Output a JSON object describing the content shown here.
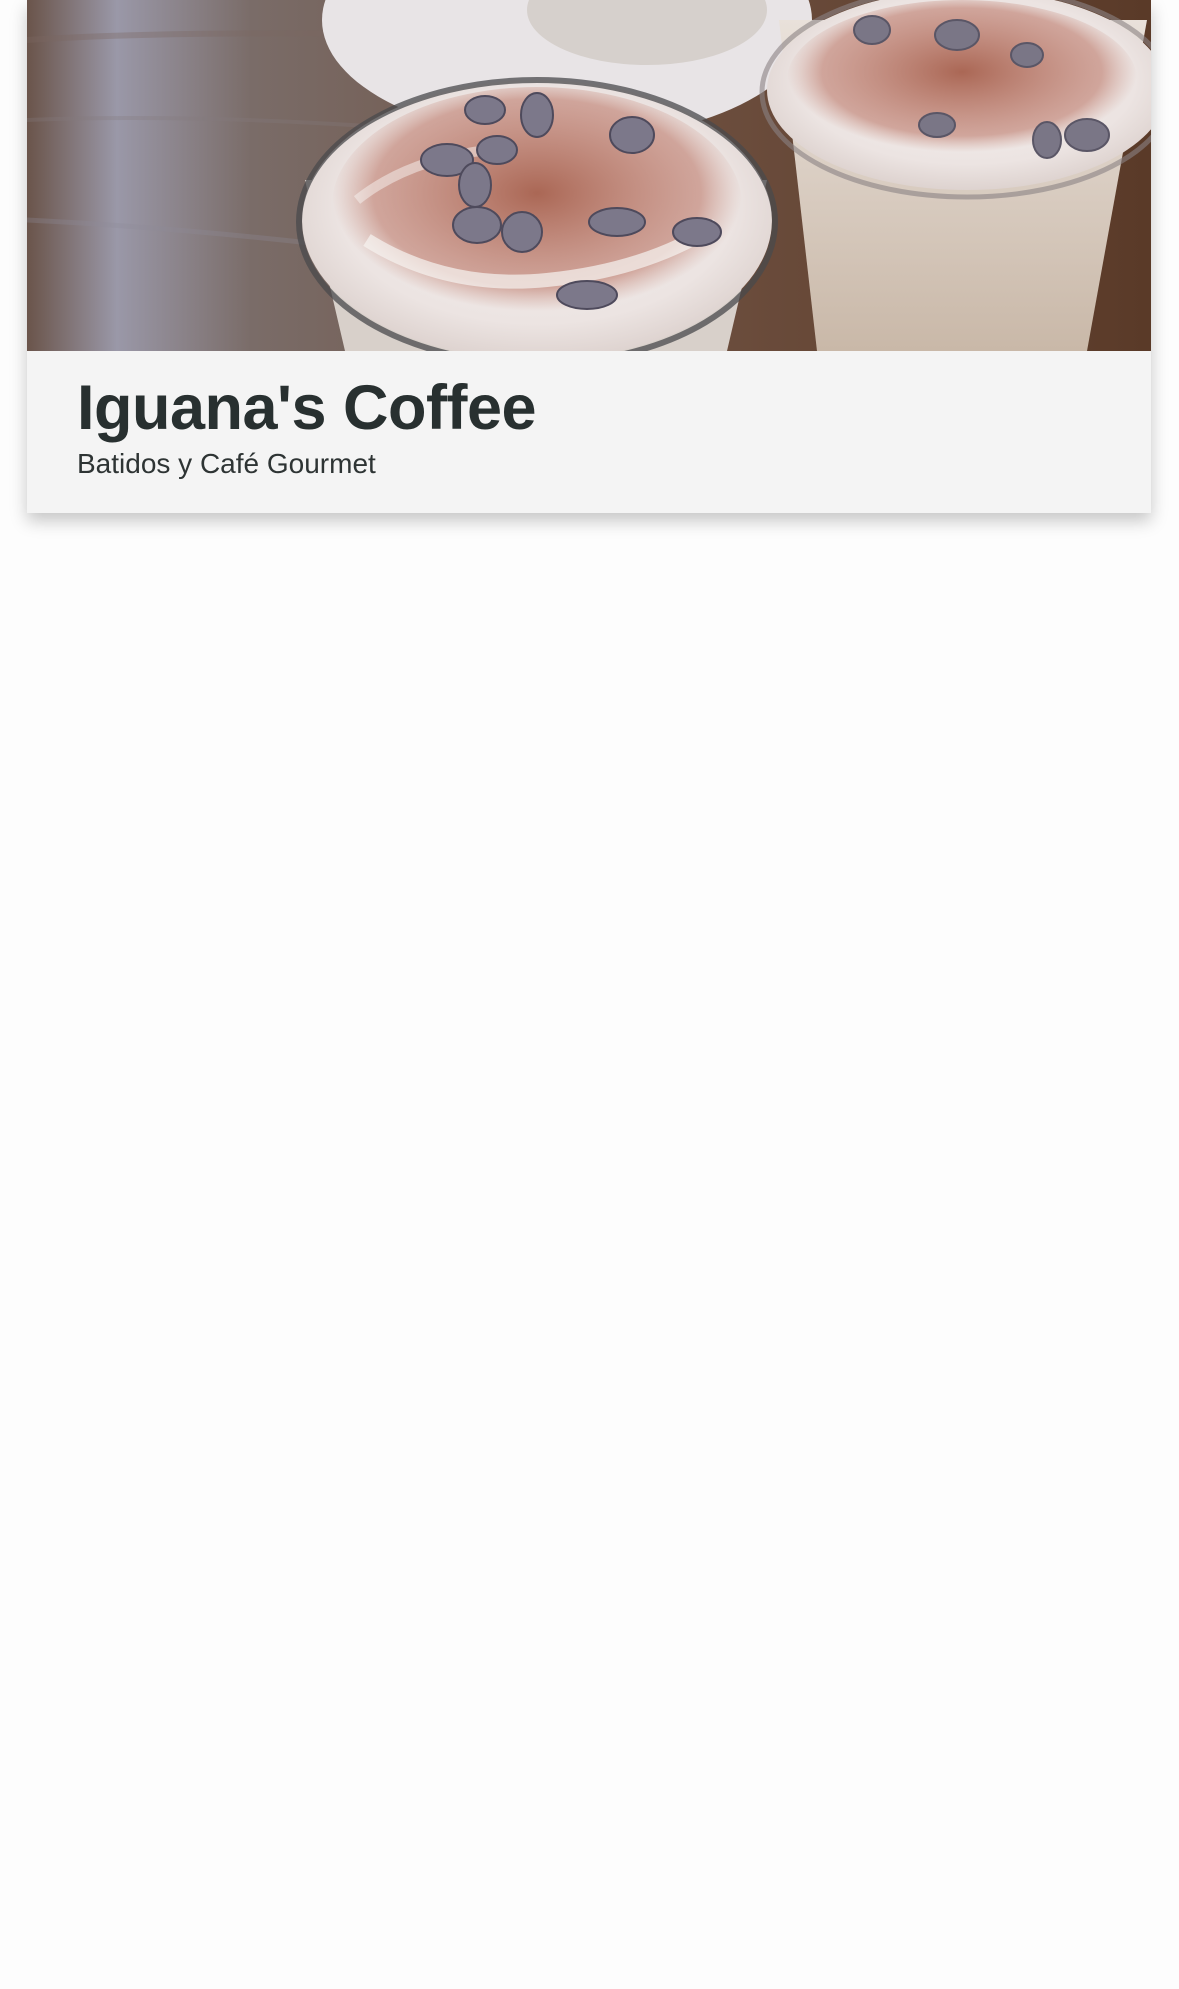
{
  "header": {
    "title": "Iguana's Coffee",
    "subtitle": "Batidos y Café Gourmet"
  },
  "hero_image": {
    "icon": "milkshake-photo",
    "description_alt": "Iguana's Coffee"
  },
  "colors": {
    "title": "#283030",
    "card_background": "#f4f4f4",
    "page_background": "#fdfdfd"
  }
}
